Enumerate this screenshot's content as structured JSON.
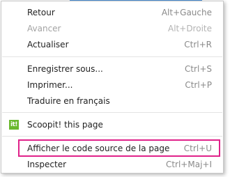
{
  "context_menu": {
    "items": [
      {
        "label": "Retour",
        "shortcut": "Alt+Gauche"
      },
      {
        "label": "Avancer",
        "shortcut": "Alt+Droite",
        "disabled": true
      },
      {
        "label": "Actualiser",
        "shortcut": "Ctrl+R"
      },
      {
        "label": "Enregistrer sous...",
        "shortcut": "Ctrl+S"
      },
      {
        "label": "Imprimer...",
        "shortcut": "Ctrl+P"
      },
      {
        "label": "Traduire en français",
        "shortcut": ""
      },
      {
        "label": "Scoopit! this page",
        "shortcut": "",
        "icon": "scoopit-icon",
        "icon_text": "it!"
      },
      {
        "label": "Afficher le code source de la page",
        "shortcut": "Ctrl+U",
        "highlighted": true
      },
      {
        "label": "Inspecter",
        "shortcut": "Ctrl+Maj+I"
      }
    ]
  },
  "colors": {
    "highlight_border": "#e0228a",
    "scoopit_green": "#6ab82d",
    "disabled_text": "#a3a3a3"
  }
}
